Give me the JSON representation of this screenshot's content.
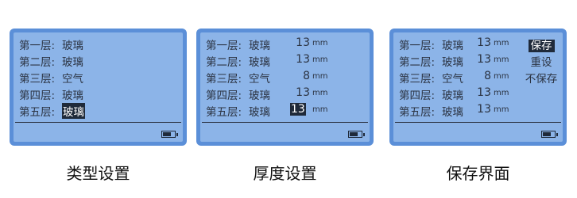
{
  "panels": [
    {
      "caption": "类型设置",
      "rows": [
        {
          "label": "第一层:",
          "value": "玻璃"
        },
        {
          "label": "第二层:",
          "value": "玻璃"
        },
        {
          "label": "第三层:",
          "value": "空气"
        },
        {
          "label": "第四层:",
          "value": "玻璃"
        },
        {
          "label": "第五层:",
          "value": "玻璃",
          "highlight": "value"
        }
      ],
      "battery_level": 0.7
    },
    {
      "caption": "厚度设置",
      "rows": [
        {
          "label": "第一层:",
          "value": "玻璃",
          "thickness": "13",
          "unit": "mm"
        },
        {
          "label": "第二层:",
          "value": "玻璃",
          "thickness": "13",
          "unit": "mm"
        },
        {
          "label": "第三层:",
          "value": "空气",
          "thickness": "8",
          "unit": "mm"
        },
        {
          "label": "第四层:",
          "value": "玻璃",
          "thickness": "13",
          "unit": "mm"
        },
        {
          "label": "第五层:",
          "value": "玻璃",
          "thickness": "13",
          "unit": "mm",
          "highlight": "thickness"
        }
      ],
      "battery_level": 0.7
    },
    {
      "caption": "保存界面",
      "rows": [
        {
          "label": "第一层:",
          "value": "玻璃",
          "thickness": "13",
          "unit": "mm"
        },
        {
          "label": "第二层:",
          "value": "玻璃",
          "thickness": "13",
          "unit": "mm"
        },
        {
          "label": "第三层:",
          "value": "空气",
          "thickness": "8",
          "unit": "mm"
        },
        {
          "label": "第四层:",
          "value": "玻璃",
          "thickness": "13",
          "unit": "mm"
        },
        {
          "label": "第五层:",
          "value": "玻璃",
          "thickness": "13",
          "unit": "mm"
        }
      ],
      "menu": [
        {
          "label": "保存",
          "selected": true
        },
        {
          "label": "重设",
          "selected": false
        },
        {
          "label": "不保存",
          "selected": false
        }
      ],
      "battery_level": 0.7
    }
  ],
  "colors": {
    "frame": "#5b8fd8",
    "screen": "#8cb4e8",
    "text": "#2b3342",
    "highlight": "#1f2a3a"
  }
}
